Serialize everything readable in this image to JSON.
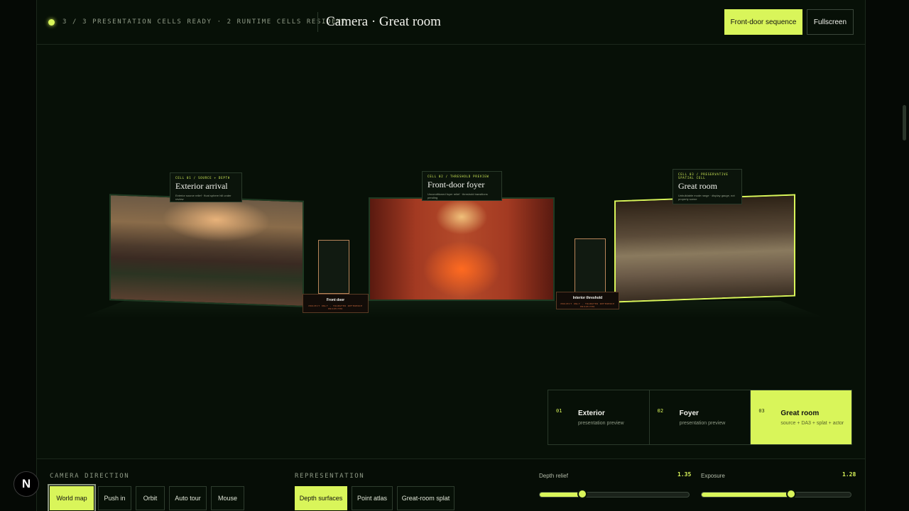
{
  "header": {
    "status": "3 / 3 PRESENTATION CELLS READY · 2 RUNTIME CELLS RESIDENT",
    "title": "Camera · Great room",
    "sequence_button": "Front-door sequence",
    "fullscreen_button": "Fullscreen"
  },
  "cells": [
    {
      "tag": "CELL 01 / SOURCE + DEPTH",
      "name": "Exterior arrival",
      "sub": "Exterior source relief · float sphere hill under review"
    },
    {
      "tag": "CELL 02 / THRESHOLD PREVIEW",
      "name": "Front-door foyer",
      "sub": "Unconditioned foyer relief · threshold transitions pending"
    },
    {
      "tag": "CELL 03 / PRESERVATIVE SPATIAL CELL",
      "name": "Great room",
      "sub": "Unbuildable mode range · display gauge, not property scene"
    }
  ],
  "doors": [
    {
      "title": "Front door",
      "sub": "PROJECT ONLY · TRANSFER REFERENCE PROJECTED"
    },
    {
      "title": "Interior threshold",
      "sub": "PROJECT ONLY · TRANSFER REFERENCE PROJECTED"
    }
  ],
  "steps": [
    {
      "num": "01",
      "title": "Exterior",
      "sub": "presentation preview",
      "active": false
    },
    {
      "num": "02",
      "title": "Foyer",
      "sub": "presentation preview",
      "active": false
    },
    {
      "num": "03",
      "title": "Great room",
      "sub": "source + DA3 + splat + actor",
      "active": true
    }
  ],
  "controls": {
    "camera_title": "CAMERA DIRECTION",
    "camera_buttons": [
      "World map",
      "Push in",
      "Orbit",
      "Auto tour",
      "Mouse"
    ],
    "camera_active": "World map",
    "representation_title": "REPRESENTATION",
    "representation_buttons": [
      "Depth surfaces",
      "Point atlas",
      "Great-room splat"
    ],
    "representation_active": "Depth surfaces",
    "depth_relief": {
      "label": "Depth relief",
      "value": "1.35",
      "fraction": 0.28
    },
    "exposure": {
      "label": "Exposure",
      "value": "1.28",
      "fraction": 0.58
    }
  },
  "badge": "N",
  "colors": {
    "accent": "#d9f55a",
    "background": "#071007",
    "border": "#1b281b"
  }
}
